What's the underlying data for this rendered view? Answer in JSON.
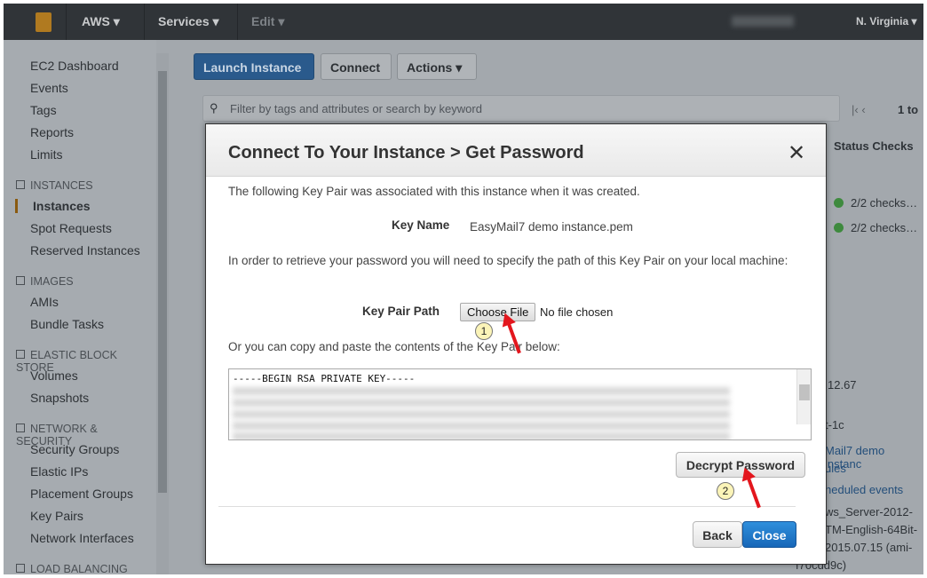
{
  "topbar": {
    "brand": "AWS",
    "services": "Services",
    "edit": "Edit",
    "region": "N. Virginia"
  },
  "sidebar": {
    "items": [
      "EC2 Dashboard",
      "Events",
      "Tags",
      "Reports",
      "Limits"
    ],
    "sections": [
      {
        "title": "INSTANCES",
        "items": [
          "Instances",
          "Spot Requests",
          "Reserved Instances"
        ]
      },
      {
        "title": "IMAGES",
        "items": [
          "AMIs",
          "Bundle Tasks"
        ]
      },
      {
        "title": "ELASTIC BLOCK STORE",
        "items": [
          "Volumes",
          "Snapshots"
        ]
      },
      {
        "title": "NETWORK & SECURITY",
        "items": [
          "Security Groups",
          "Elastic IPs",
          "Placement Groups",
          "Key Pairs",
          "Network Interfaces"
        ]
      },
      {
        "title": "LOAD BALANCING",
        "items": []
      }
    ],
    "active": "Instances"
  },
  "toolbar": {
    "launch": "Launch Instance",
    "connect": "Connect",
    "actions": "Actions"
  },
  "search": {
    "placeholder": "Filter by tags and attributes or search by keyword"
  },
  "pager": {
    "text": "1 to"
  },
  "table": {
    "status_header": "Status Checks",
    "rows": [
      "2/2 checks…",
      "2/2 checks…"
    ]
  },
  "details": [
    "12.67",
    "t-1c",
    "Mail7 demo instanc",
    "ules",
    "heduled events",
    "ws_Server-2012-",
    "TM-English-64Bit-",
    "2015.07.15 (ami-",
    "f70cdd9c)"
  ],
  "modal": {
    "title": "Connect To Your Instance > Get Password",
    "intro": "The following Key Pair was associated with this instance when it was created.",
    "key_name_label": "Key Name",
    "key_name": "EasyMail7 demo instance.pem",
    "path_text": "In order to retrieve your password you will need to specify the path of this Key Pair on your local machine:",
    "key_path_label": "Key Pair Path",
    "choose_file": "Choose File",
    "no_file": "No file chosen",
    "paste_text": "Or you can copy and paste the contents of the Key Pair below:",
    "textarea_first": "-----BEGIN RSA PRIVATE KEY-----",
    "decrypt": "Decrypt Password",
    "back": "Back",
    "close": "Close"
  },
  "annotations": {
    "step1": "1",
    "step2": "2",
    "arrow_color": "#e3161d"
  }
}
